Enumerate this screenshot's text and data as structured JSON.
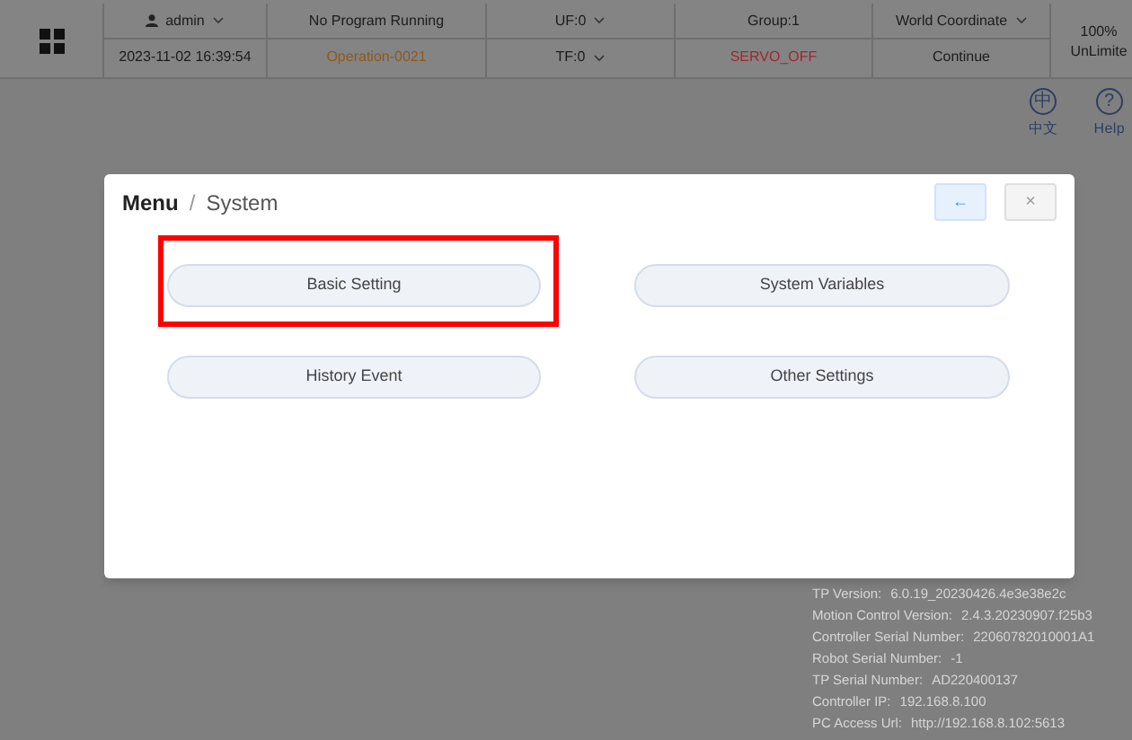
{
  "header": {
    "user": "admin",
    "datetime": "2023-11-02 16:39:54",
    "program_status": "No Program Running",
    "operation": "Operation-0021",
    "uf": "UF:0",
    "tf": "TF:0",
    "group": "Group:1",
    "servo": "SERVO_OFF",
    "coordinate": "World Coordinate",
    "mode": "Continue",
    "speed": "100%",
    "limit": "UnLimite"
  },
  "toolbar": [
    {
      "label": "中文",
      "glyph": "中"
    },
    {
      "label": "Help",
      "glyph": "?"
    }
  ],
  "info": [
    {
      "label": "TP Version:",
      "value": "6.0.19_20230426.4e3e38e2c"
    },
    {
      "label": "Motion Control Version:",
      "value": "2.4.3.20230907.f25b3"
    },
    {
      "label": "Controller Serial Number:",
      "value": "22060782010001A1"
    },
    {
      "label": "Robot Serial Number:",
      "value": "-1"
    },
    {
      "label": "TP Serial Number:",
      "value": "AD220400137"
    },
    {
      "label": "Controller IP:",
      "value": "192.168.8.100"
    },
    {
      "label": "PC Access Url:",
      "value": "http://192.168.8.102:5613"
    }
  ],
  "dialog": {
    "title": "Menu",
    "separator": "/",
    "subtitle": "System",
    "back": "←",
    "close": "×",
    "items": [
      {
        "label": "Basic Setting",
        "highlighted": true
      },
      {
        "label": "System Variables",
        "highlighted": false
      },
      {
        "label": "History Event",
        "highlighted": false
      },
      {
        "label": "Other Settings",
        "highlighted": false
      }
    ]
  }
}
